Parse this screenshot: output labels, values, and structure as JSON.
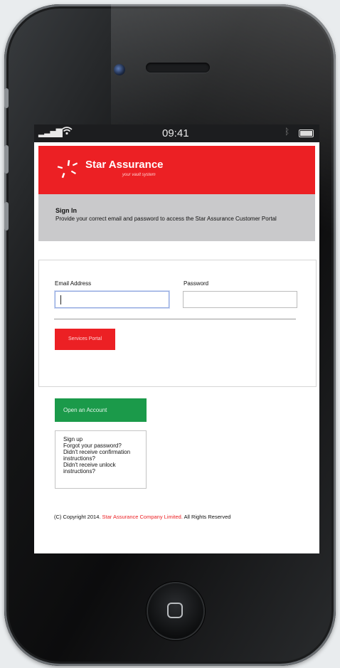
{
  "status_bar": {
    "signal": "▂▃▅▇",
    "wifi_icon": "wifi-icon",
    "time": "09:41",
    "bluetooth_icon": "ᛒ"
  },
  "header": {
    "brand": "Star Assurance",
    "tagline": "your vault system",
    "brand_color": "#ec2024"
  },
  "signin": {
    "title": "Sign In",
    "description": "Provide your correct email and password to access the Star Assurance Customer Portal"
  },
  "form": {
    "email_label": "Email Address",
    "email_value": "",
    "password_label": "Password",
    "password_value": "",
    "submit_label": "Services Portal"
  },
  "open_account": {
    "label": "Open an Account",
    "color": "#1b9a4a"
  },
  "links": [
    "Sign up",
    "Forgot your password?",
    "Didn't receive confirmation instructions?",
    "Didn't receive unlock instructions?"
  ],
  "footer": {
    "prefix": "(C) Copyright 2014.",
    "company": "Star Assurance Company Limited.",
    "suffix": "All Rights Reserved"
  }
}
